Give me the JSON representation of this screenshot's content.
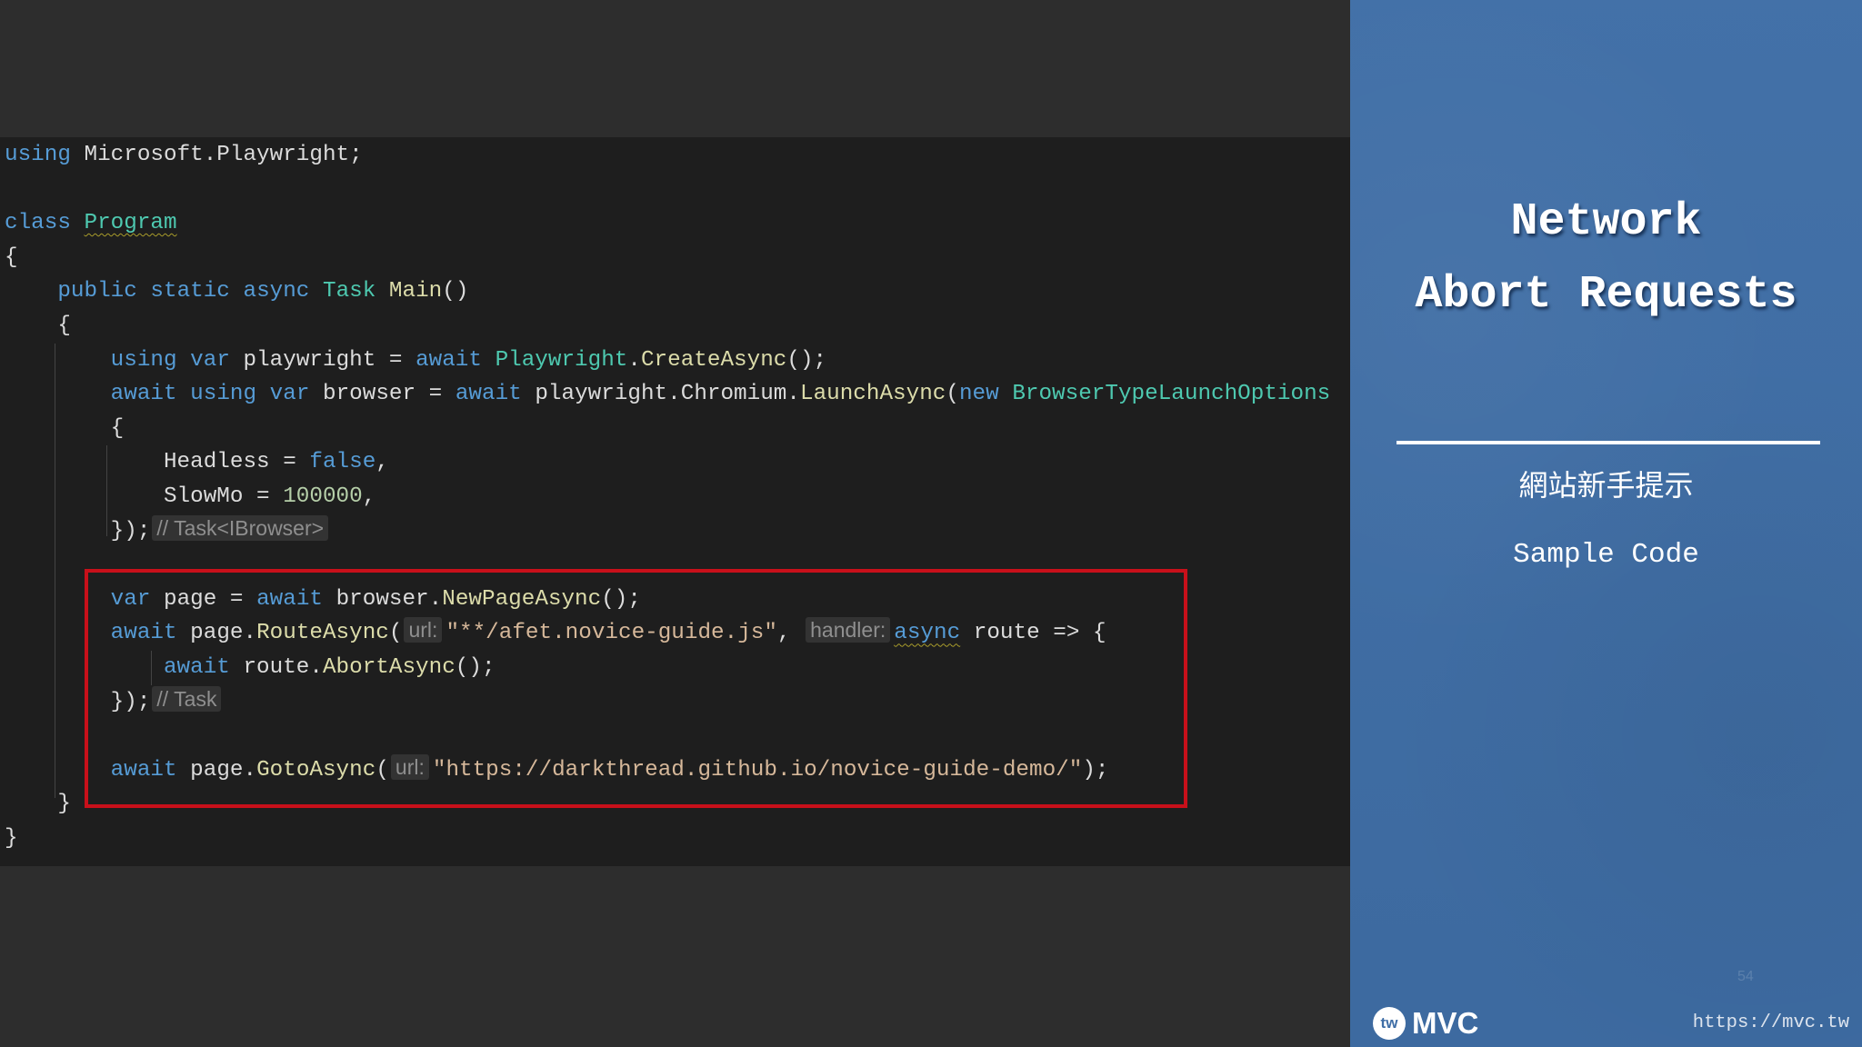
{
  "colors": {
    "keyword": "#569cd6",
    "type": "#4ec9b0",
    "method": "#dcdcaa",
    "identifier": "#dcdcdc",
    "string": "#d6b89a",
    "number": "#b5cea8",
    "hint_text": "#8f8f8f",
    "highlight_box": "#c8101a",
    "slide_panel": "#3f6ea6"
  },
  "editor": {
    "lines": [
      {
        "tokens": [
          {
            "t": "using",
            "k": "kw"
          },
          {
            "t": " ",
            "k": "ws"
          },
          {
            "t": "Microsoft.Playwright;",
            "k": "id"
          }
        ]
      },
      {
        "tokens": []
      },
      {
        "tokens": [
          {
            "t": "class",
            "k": "kw"
          },
          {
            "t": " ",
            "k": "ws"
          },
          {
            "t": "Program",
            "k": "type",
            "sq": true
          }
        ]
      },
      {
        "tokens": [
          {
            "t": "{",
            "k": "p"
          }
        ]
      },
      {
        "tokens": [
          {
            "t": "    ",
            "k": "ws"
          },
          {
            "t": "public",
            "k": "kw"
          },
          {
            "t": " ",
            "k": "ws"
          },
          {
            "t": "static",
            "k": "kw"
          },
          {
            "t": " ",
            "k": "ws"
          },
          {
            "t": "async",
            "k": "kw"
          },
          {
            "t": " ",
            "k": "ws"
          },
          {
            "t": "Task",
            "k": "type"
          },
          {
            "t": " ",
            "k": "ws"
          },
          {
            "t": "Main",
            "k": "fn"
          },
          {
            "t": "()",
            "k": "p"
          }
        ]
      },
      {
        "tokens": [
          {
            "t": "    ",
            "k": "ws"
          },
          {
            "t": "{",
            "k": "p"
          }
        ]
      },
      {
        "tokens": [
          {
            "t": "        ",
            "k": "ws"
          },
          {
            "t": "using",
            "k": "kw"
          },
          {
            "t": " ",
            "k": "ws"
          },
          {
            "t": "var",
            "k": "kw"
          },
          {
            "t": " ",
            "k": "ws"
          },
          {
            "t": "playwright",
            "k": "id"
          },
          {
            "t": " = ",
            "k": "p"
          },
          {
            "t": "await",
            "k": "kw"
          },
          {
            "t": " ",
            "k": "ws"
          },
          {
            "t": "Playwright",
            "k": "type"
          },
          {
            "t": ".",
            "k": "p"
          },
          {
            "t": "CreateAsync",
            "k": "fn"
          },
          {
            "t": "();",
            "k": "p"
          }
        ]
      },
      {
        "tokens": [
          {
            "t": "        ",
            "k": "ws"
          },
          {
            "t": "await",
            "k": "kw"
          },
          {
            "t": " ",
            "k": "ws"
          },
          {
            "t": "using",
            "k": "kw"
          },
          {
            "t": " ",
            "k": "ws"
          },
          {
            "t": "var",
            "k": "kw"
          },
          {
            "t": " ",
            "k": "ws"
          },
          {
            "t": "browser",
            "k": "id"
          },
          {
            "t": " = ",
            "k": "p"
          },
          {
            "t": "await",
            "k": "kw"
          },
          {
            "t": " ",
            "k": "ws"
          },
          {
            "t": "playwright",
            "k": "id"
          },
          {
            "t": ".",
            "k": "p"
          },
          {
            "t": "Chromium",
            "k": "id"
          },
          {
            "t": ".",
            "k": "p"
          },
          {
            "t": "LaunchAsync",
            "k": "fn"
          },
          {
            "t": "(",
            "k": "p"
          },
          {
            "t": "new",
            "k": "kw"
          },
          {
            "t": " ",
            "k": "ws"
          },
          {
            "t": "BrowserTypeLaunchOptions",
            "k": "type"
          }
        ]
      },
      {
        "tokens": [
          {
            "t": "        ",
            "k": "ws"
          },
          {
            "t": "{",
            "k": "p"
          }
        ]
      },
      {
        "tokens": [
          {
            "t": "            ",
            "k": "ws"
          },
          {
            "t": "Headless",
            "k": "id"
          },
          {
            "t": " = ",
            "k": "p"
          },
          {
            "t": "false",
            "k": "kw"
          },
          {
            "t": ",",
            "k": "p"
          }
        ]
      },
      {
        "tokens": [
          {
            "t": "            ",
            "k": "ws"
          },
          {
            "t": "SlowMo",
            "k": "id"
          },
          {
            "t": " = ",
            "k": "p"
          },
          {
            "t": "100000",
            "k": "num"
          },
          {
            "t": ",",
            "k": "p"
          }
        ]
      },
      {
        "tokens": [
          {
            "t": "        ",
            "k": "ws"
          },
          {
            "t": "});",
            "k": "p"
          },
          {
            "t": "// Task<IBrowser>",
            "k": "hint"
          }
        ]
      },
      {
        "tokens": []
      },
      {
        "tokens": [
          {
            "t": "        ",
            "k": "ws"
          },
          {
            "t": "var",
            "k": "kw"
          },
          {
            "t": " ",
            "k": "ws"
          },
          {
            "t": "page",
            "k": "id"
          },
          {
            "t": " = ",
            "k": "p"
          },
          {
            "t": "await",
            "k": "kw"
          },
          {
            "t": " ",
            "k": "ws"
          },
          {
            "t": "browser",
            "k": "id"
          },
          {
            "t": ".",
            "k": "p"
          },
          {
            "t": "NewPageAsync",
            "k": "fn"
          },
          {
            "t": "();",
            "k": "p"
          }
        ]
      },
      {
        "tokens": [
          {
            "t": "        ",
            "k": "ws"
          },
          {
            "t": "await",
            "k": "kw"
          },
          {
            "t": " ",
            "k": "ws"
          },
          {
            "t": "page",
            "k": "id"
          },
          {
            "t": ".",
            "k": "p"
          },
          {
            "t": "RouteAsync",
            "k": "fn"
          },
          {
            "t": "(",
            "k": "p"
          },
          {
            "t": "url:",
            "k": "hint"
          },
          {
            "t": "\"**/afet.novice-guide.js\"",
            "k": "str"
          },
          {
            "t": ", ",
            "k": "p"
          },
          {
            "t": "handler:",
            "k": "hint"
          },
          {
            "t": "async",
            "k": "kw",
            "sq": true
          },
          {
            "t": " ",
            "k": "ws"
          },
          {
            "t": "route",
            "k": "id"
          },
          {
            "t": " => {",
            "k": "p"
          }
        ]
      },
      {
        "tokens": [
          {
            "t": "            ",
            "k": "ws"
          },
          {
            "t": "await",
            "k": "kw"
          },
          {
            "t": " ",
            "k": "ws"
          },
          {
            "t": "route",
            "k": "id"
          },
          {
            "t": ".",
            "k": "p"
          },
          {
            "t": "AbortAsync",
            "k": "fn"
          },
          {
            "t": "();",
            "k": "p"
          }
        ]
      },
      {
        "tokens": [
          {
            "t": "        ",
            "k": "ws"
          },
          {
            "t": "});",
            "k": "p"
          },
          {
            "t": "// Task",
            "k": "hint"
          }
        ]
      },
      {
        "tokens": []
      },
      {
        "tokens": [
          {
            "t": "        ",
            "k": "ws"
          },
          {
            "t": "await",
            "k": "kw"
          },
          {
            "t": " ",
            "k": "ws"
          },
          {
            "t": "page",
            "k": "id"
          },
          {
            "t": ".",
            "k": "p"
          },
          {
            "t": "GotoAsync",
            "k": "fn"
          },
          {
            "t": "(",
            "k": "p"
          },
          {
            "t": "url:",
            "k": "hint"
          },
          {
            "t": "\"https://darkthread.github.io/novice-guide-demo/\"",
            "k": "str"
          },
          {
            "t": ");",
            "k": "p"
          }
        ]
      },
      {
        "tokens": [
          {
            "t": "    ",
            "k": "ws"
          },
          {
            "t": "}",
            "k": "p"
          }
        ]
      },
      {
        "tokens": [
          {
            "t": "}",
            "k": "p"
          }
        ]
      }
    ]
  },
  "slide": {
    "title_lines": [
      "Network",
      "Abort Requests"
    ],
    "subtitle_zh": "網站新手提示",
    "subtitle_en": "Sample Code",
    "page_number": "54",
    "logo": {
      "badge": "tw",
      "text": "MVC",
      "icon": "twmvc-logo"
    },
    "url": "https://mvc.tw"
  }
}
